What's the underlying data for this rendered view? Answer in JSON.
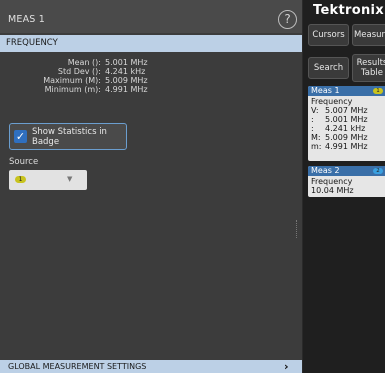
{
  "panel": {
    "title": "MEAS 1",
    "help_glyph": "?",
    "section": "FREQUENCY",
    "stats": [
      {
        "label": "Mean ():",
        "value": "5.001 MHz"
      },
      {
        "label": "Std Dev ():",
        "value": "4.241 kHz"
      },
      {
        "label": "Maximum (M):",
        "value": "5.009 MHz"
      },
      {
        "label": "Minimum (m):",
        "value": "4.991 MHz"
      }
    ],
    "show_stats_label": "Show Statistics in Badge",
    "show_stats_checked": true,
    "source_label": "Source",
    "source_value": "1",
    "source_color": "#c8c31e",
    "global_settings": "GLOBAL MEASUREMENT SETTINGS"
  },
  "rail": {
    "logo": "Tektronix",
    "buttons": {
      "cursors": "Cursors",
      "measure": "Measure",
      "search": "Search",
      "results_line1": "Results",
      "results_line2": "Table"
    },
    "meas1": {
      "title": "Meas 1",
      "channel": "1",
      "channel_color": "#c8c31e",
      "type": "Frequency",
      "rows": [
        {
          "key": "V:",
          "value": "5.007 MHz"
        },
        {
          "key": ":",
          "value": "5.001 MHz"
        },
        {
          "key": ":",
          "value": "4.241 kHz"
        },
        {
          "key": "M:",
          "value": "5.009 MHz"
        },
        {
          "key": "m:",
          "value": "4.991 MHz"
        }
      ]
    },
    "meas2": {
      "title": "Meas 2",
      "channel": "2",
      "channel_color": "#3aa0e0",
      "type": "Frequency",
      "value": "10.04 MHz"
    }
  }
}
